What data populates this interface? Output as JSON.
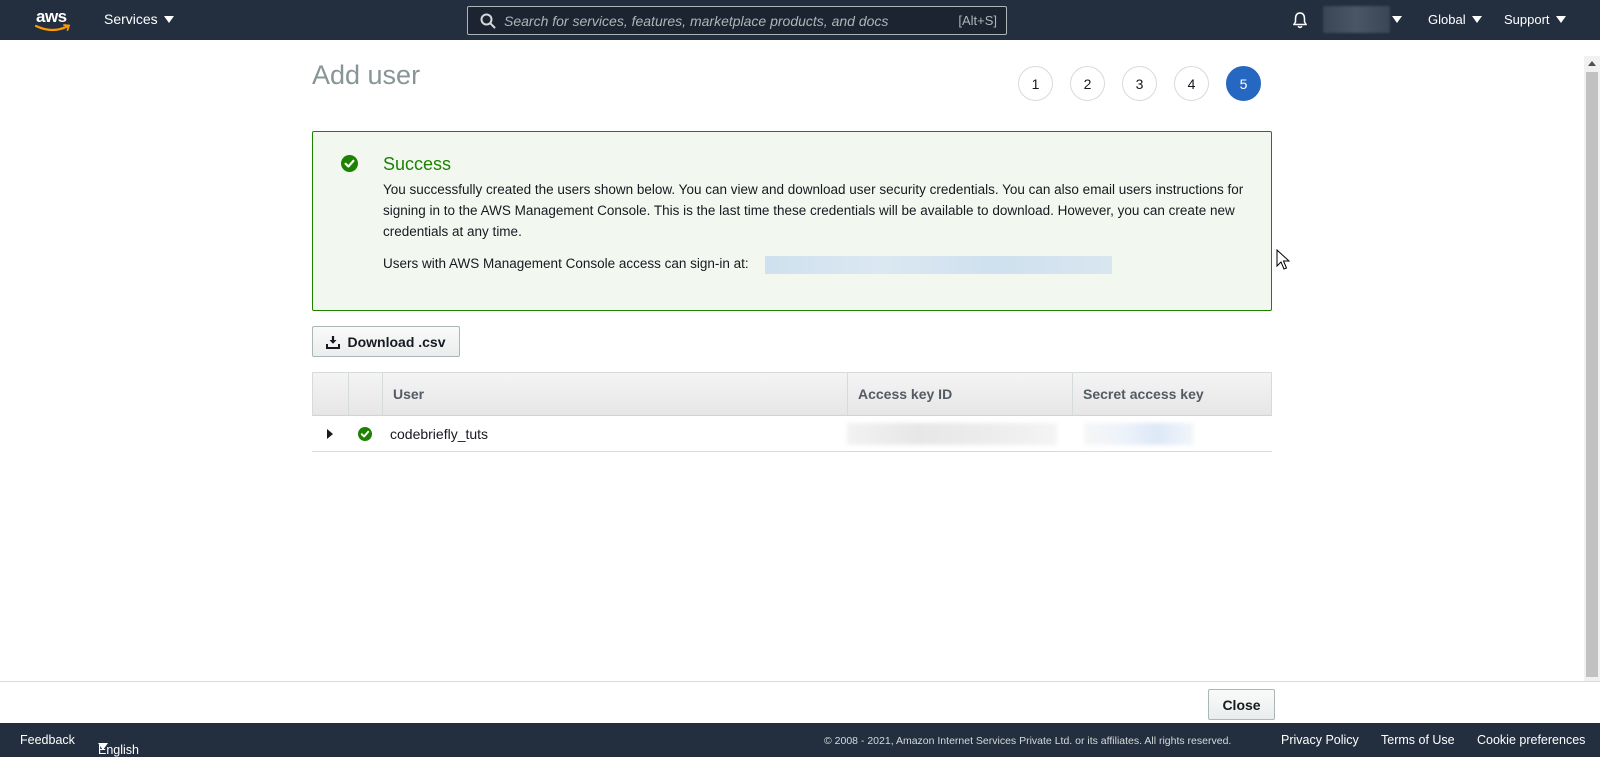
{
  "nav": {
    "logo_text": "aws",
    "services_label": "Services",
    "search_placeholder": "Search for services, features, marketplace products, and docs",
    "search_shortcut": "[Alt+S]",
    "region_label": "Global",
    "support_label": "Support",
    "colors": {
      "bar": "#232f3e",
      "smile": "#ff9900"
    }
  },
  "page": {
    "title": "Add user",
    "steps": [
      "1",
      "2",
      "3",
      "4",
      "5"
    ],
    "active_step": "5"
  },
  "alert": {
    "title": "Success",
    "body": "You successfully created the users shown below. You can view and download user security credentials. You can also email users instructions for signing in to the AWS Management Console. This is the last time these credentials will be available to download. However, you can create new credentials at any time.",
    "signin_text": "Users with AWS Management Console access can sign-in at:",
    "colors": {
      "border": "#1d8102",
      "background": "#f2f8f0"
    }
  },
  "download_label": "Download .csv",
  "table": {
    "columns": [
      "",
      "",
      "User",
      "Access key ID",
      "Secret access key"
    ],
    "rows": [
      {
        "user": "codebriefly_tuts",
        "status": "success"
      }
    ]
  },
  "actions": {
    "close_label": "Close"
  },
  "footer": {
    "feedback": "Feedback",
    "language": "English (US)",
    "copyright": "© 2008 - 2021, Amazon Internet Services Private Ltd. or its affiliates. All rights reserved.",
    "privacy": "Privacy Policy",
    "terms": "Terms of Use",
    "cookies": "Cookie preferences"
  }
}
